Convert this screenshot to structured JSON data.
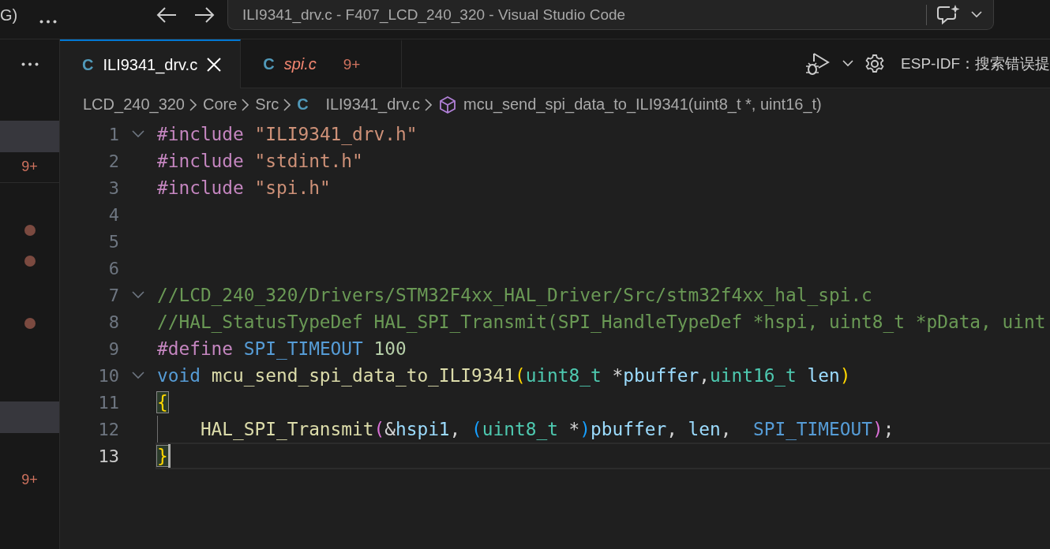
{
  "title_bar": {
    "cut_label": "G)",
    "command_center": {
      "title": "ILI9341_drv.c - F407_LCD_240_320 - Visual Studio Code"
    }
  },
  "sidebar": {
    "rows": [
      {
        "kind": "blank",
        "selected": true
      },
      {
        "kind": "badge",
        "selected": false,
        "badge": "9+"
      },
      {
        "kind": "blank",
        "selected": false
      },
      {
        "kind": "dot",
        "selected": false
      },
      {
        "kind": "dot",
        "selected": false
      },
      {
        "kind": "blank",
        "selected": false
      },
      {
        "kind": "dot",
        "selected": false
      },
      {
        "kind": "blank",
        "selected": false
      },
      {
        "kind": "blank",
        "selected": false
      },
      {
        "kind": "blank",
        "selected": true
      },
      {
        "kind": "blank",
        "selected": false
      },
      {
        "kind": "badge",
        "selected": false,
        "badge": "9+"
      }
    ]
  },
  "tabs": [
    {
      "icon": "C",
      "label": "ILI9341_drv.c",
      "selected": true,
      "preview": false
    },
    {
      "icon": "C",
      "label": "spi.c",
      "selected": false,
      "preview": true,
      "problems": "9+"
    }
  ],
  "tab_actions": {
    "label": "ESP-IDF：搜索错误提"
  },
  "breadcrumbs": [
    {
      "kind": "folder",
      "label": "LCD_240_320"
    },
    {
      "kind": "folder",
      "label": "Core"
    },
    {
      "kind": "folder",
      "label": "Src"
    },
    {
      "kind": "file",
      "icon": "C",
      "label": "ILI9341_drv.c"
    },
    {
      "kind": "symbol",
      "label": "mcu_send_spi_data_to_ILI9341(uint8_t *, uint16_t)"
    }
  ],
  "editor": {
    "lines": [
      {
        "number": "1",
        "fold": true,
        "current": false,
        "tokens": [
          {
            "t": "#include ",
            "color": "#c586c0"
          },
          {
            "t": "\"ILI9341_drv.h\"",
            "color": "#ce9178"
          }
        ]
      },
      {
        "number": "2",
        "fold": false,
        "current": false,
        "tokens": [
          {
            "t": "#include ",
            "color": "#c586c0"
          },
          {
            "t": "\"stdint.h\"",
            "color": "#ce9178"
          }
        ]
      },
      {
        "number": "3",
        "fold": false,
        "current": false,
        "tokens": [
          {
            "t": "#include ",
            "color": "#c586c0"
          },
          {
            "t": "\"spi.h\"",
            "color": "#ce9178"
          }
        ]
      },
      {
        "number": "4",
        "fold": false,
        "current": false
      },
      {
        "number": "5",
        "fold": false,
        "current": false
      },
      {
        "number": "6",
        "fold": false,
        "current": false
      },
      {
        "number": "7",
        "fold": true,
        "current": false,
        "tokens": [
          {
            "t": "//LCD_240_320/Drivers/STM32F4xx_HAL_Driver/Src/stm32f4xx_hal_spi.c",
            "color": "#6a9955"
          }
        ]
      },
      {
        "number": "8",
        "fold": false,
        "current": false,
        "tokens": [
          {
            "t": "//HAL_StatusTypeDef HAL_SPI_Transmit(SPI_HandleTypeDef *hspi, uint8_t *pData, uint",
            "color": "#6a9955"
          }
        ]
      },
      {
        "number": "9",
        "fold": false,
        "current": false,
        "tokens": [
          {
            "t": "#define ",
            "color": "#c586c0"
          },
          {
            "t": "SPI_TIMEOUT ",
            "color": "#569cd6"
          },
          {
            "t": "100",
            "color": "#b5cea8"
          }
        ]
      },
      {
        "number": "10",
        "fold": true,
        "current": false,
        "tokens": [
          {
            "t": "void ",
            "color": "#569cd6"
          },
          {
            "t": "mcu_send_spi_data_to_ILI9341",
            "color": "#dcdcaa"
          },
          {
            "t": "(",
            "color": "#ffd700"
          },
          {
            "t": "uint8_t ",
            "color": "#4ec9b0"
          },
          {
            "t": "*",
            "color": "#d4d4d4"
          },
          {
            "t": "pbuffer",
            "color": "#9cdcfe"
          },
          {
            "t": ",",
            "color": "#d4d4d4"
          },
          {
            "t": "uint16_t ",
            "color": "#4ec9b0"
          },
          {
            "t": "len",
            "color": "#9cdcfe"
          },
          {
            "t": ")",
            "color": "#ffd700"
          }
        ]
      },
      {
        "number": "11",
        "fold": false,
        "current": false,
        "tokens": [
          {
            "t": "{",
            "color": "#ffd700",
            "bracket_match": true
          }
        ]
      },
      {
        "number": "12",
        "fold": false,
        "current": false,
        "indent_guide": true,
        "tokens": [
          {
            "t": "HAL_SPI_Transmit",
            "color": "#dcdcaa"
          },
          {
            "t": "(",
            "color": "#da70d6"
          },
          {
            "t": "&",
            "color": "#d4d4d4"
          },
          {
            "t": "hspi1",
            "color": "#9cdcfe"
          },
          {
            "t": ", ",
            "color": "#d4d4d4"
          },
          {
            "t": "(",
            "color": "#179fff"
          },
          {
            "t": "uint8_t ",
            "color": "#4ec9b0"
          },
          {
            "t": "*",
            "color": "#d4d4d4"
          },
          {
            "t": ")",
            "color": "#179fff"
          },
          {
            "t": "pbuffer",
            "color": "#9cdcfe"
          },
          {
            "t": ", ",
            "color": "#d4d4d4"
          },
          {
            "t": "len",
            "color": "#9cdcfe"
          },
          {
            "t": ",  ",
            "color": "#d4d4d4"
          },
          {
            "t": "SPI_TIMEOUT",
            "color": "#569cd6"
          },
          {
            "t": ")",
            "color": "#da70d6"
          },
          {
            "t": ";",
            "color": "#d4d4d4"
          }
        ]
      },
      {
        "number": "13",
        "fold": false,
        "current": true,
        "tokens": [
          {
            "t": "}",
            "color": "#ffd700",
            "bracket_match": true
          }
        ]
      }
    ]
  }
}
